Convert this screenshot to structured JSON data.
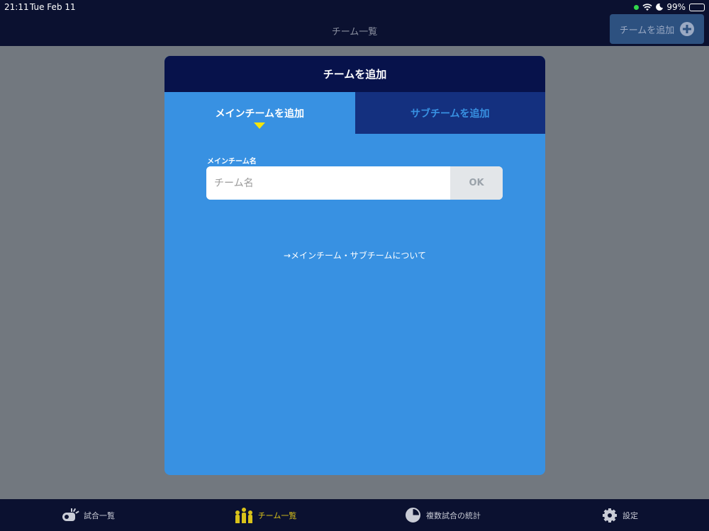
{
  "status_bar": {
    "time": "21:11",
    "date": "Tue Feb 11",
    "battery": "99%"
  },
  "header": {
    "title": "チーム一覧",
    "add_button": "チームを追加"
  },
  "modal": {
    "title": "チームを追加",
    "tabs": [
      {
        "label": "メインチームを追加",
        "active": true
      },
      {
        "label": "サブチームを追加",
        "active": false
      }
    ],
    "field_label": "メインチーム名",
    "input_placeholder": "チーム名",
    "input_value": "",
    "ok_label": "OK",
    "about_link": "→メインチーム・サブチームについて"
  },
  "tabbar": {
    "items": [
      {
        "label": "試合一覧",
        "icon": "whistle-icon",
        "selected": false
      },
      {
        "label": "チーム一覧",
        "icon": "team-people-icon",
        "selected": true
      },
      {
        "label": "複数試合の統計",
        "icon": "pie-chart-icon",
        "selected": false
      },
      {
        "label": "設定",
        "icon": "gear-icon",
        "selected": false
      }
    ]
  },
  "colors": {
    "header_bg": "#0b1130",
    "modal_header_bg": "#07124b",
    "modal_bg": "#3891e2",
    "inactive_tab_bg": "#14307f",
    "caret": "#f5e50a",
    "selected_tab_text": "#d9c21a",
    "overlay": "#72787f"
  }
}
